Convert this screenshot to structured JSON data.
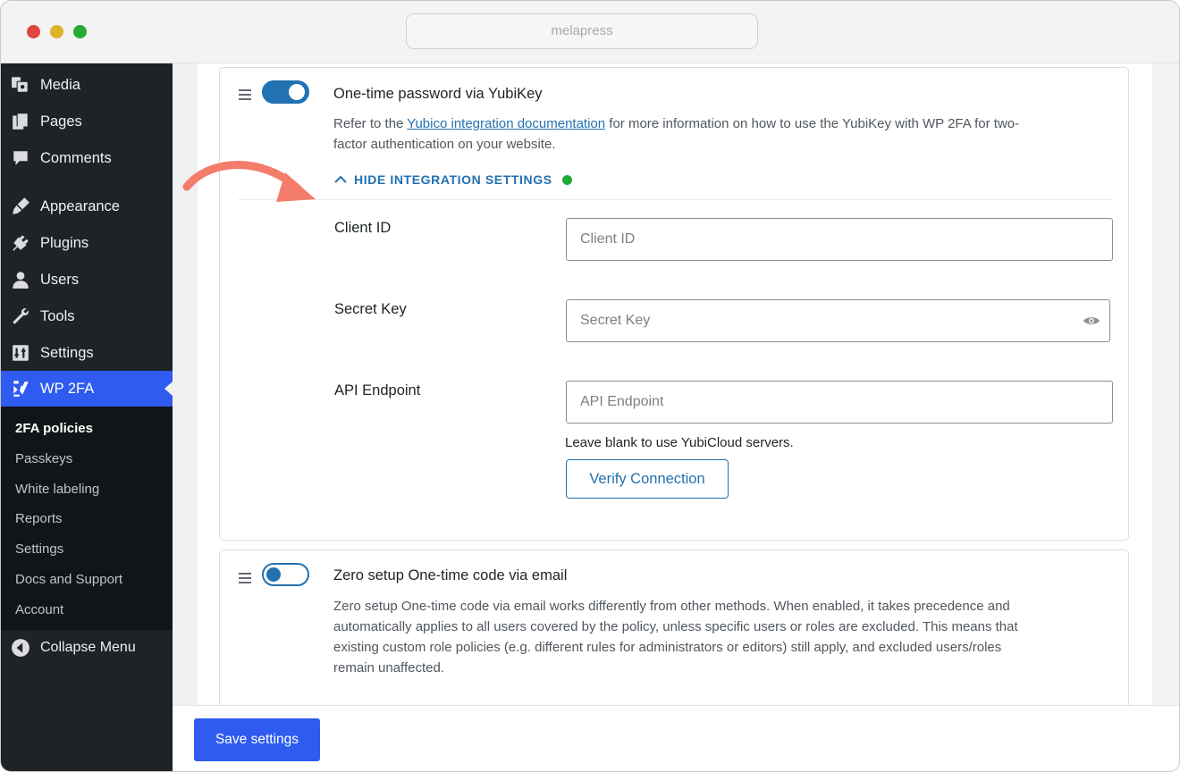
{
  "window": {
    "url": "melapress"
  },
  "sidebar": {
    "items": [
      {
        "label": "Media",
        "icon": "media-icon"
      },
      {
        "label": "Pages",
        "icon": "pages-icon"
      },
      {
        "label": "Comments",
        "icon": "comments-icon"
      },
      {
        "label": "Appearance",
        "icon": "appearance-icon"
      },
      {
        "label": "Plugins",
        "icon": "plugins-icon"
      },
      {
        "label": "Users",
        "icon": "users-icon"
      },
      {
        "label": "Tools",
        "icon": "tools-icon"
      },
      {
        "label": "Settings",
        "icon": "settings-icon"
      },
      {
        "label": "WP 2FA",
        "icon": "wp2fa-icon"
      }
    ],
    "submenu": [
      "2FA policies",
      "Passkeys",
      "White labeling",
      "Reports",
      "Settings",
      "Docs and Support",
      "Account"
    ],
    "collapse_label": "Collapse Menu"
  },
  "yubikey": {
    "title": "One-time password via YubiKey",
    "enabled": true,
    "desc_prefix": "Refer to the ",
    "desc_link": "Yubico integration documentation",
    "desc_suffix_line1": " for more information on how to use the YubiKey with WP 2FA for two-",
    "desc_line2": "factor authentication on your website.",
    "toggle_settings_label": "HIDE INTEGRATION SETTINGS",
    "fields": {
      "client_id_label": "Client ID",
      "client_id_placeholder": "Client ID",
      "secret_key_label": "Secret Key",
      "secret_key_placeholder": "Secret Key",
      "api_endpoint_label": "API Endpoint",
      "api_endpoint_placeholder": "API Endpoint",
      "api_help": "Leave blank to use YubiCloud servers."
    },
    "verify_label": "Verify Connection"
  },
  "email": {
    "title": "Zero setup One-time code via email",
    "enabled": false,
    "desc_lines": [
      "Zero setup One-time code via email works differently from other methods. When enabled, it takes precedence and",
      "automatically applies to all users covered by the policy, unless specific users or roles are excluded. This means that",
      "existing custom role policies (e.g. different rules for administrators or editors) still apply, and excluded users/roles",
      "remain unaffected."
    ]
  },
  "footer": {
    "save_label": "Save settings"
  },
  "colors": {
    "accent": "#2271b1",
    "primary_button": "#2f5bf0",
    "status_ok": "#1eaa38",
    "arrow": "#f47c6b"
  }
}
